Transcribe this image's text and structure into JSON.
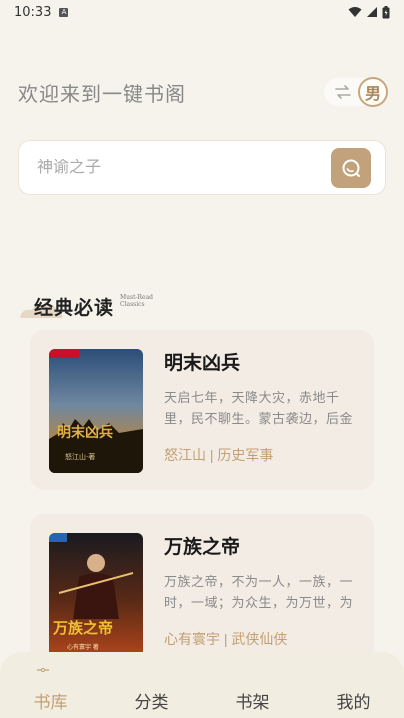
{
  "status": {
    "time": "10:33",
    "notification_glyph": "A"
  },
  "header": {
    "welcome": "欢迎来到一键书阁",
    "gender_label": "男",
    "swap_icon": "swap-arrows"
  },
  "search": {
    "placeholder": "神谕之子",
    "icon": "search"
  },
  "section": {
    "title": "经典必读",
    "subtitle": "Must-Read Classics"
  },
  "books": [
    {
      "title": "明末凶兵",
      "description": "天启七年，天降大灾，赤地千里，民不聊生。蒙古袭边，后金",
      "author": "怒江山",
      "category": "历史军事",
      "cover_title": "明末凶兵",
      "cover_author": "怒江山·著"
    },
    {
      "title": "万族之帝",
      "description": "万族之帝，不为一人，一族，一时，一域；为众生，为万世，为",
      "author": "心有寰宇",
      "category": "武侠仙侠",
      "cover_title": "万族之帝",
      "cover_author": "心有寰宇 著"
    }
  ],
  "nav": [
    {
      "label": "书库",
      "active": true
    },
    {
      "label": "分类",
      "active": false
    },
    {
      "label": "书架",
      "active": false
    },
    {
      "label": "我的",
      "active": false
    }
  ],
  "colors": {
    "accent": "#c3a074",
    "background": "#f5f3ec",
    "card": "#f3ece4"
  }
}
